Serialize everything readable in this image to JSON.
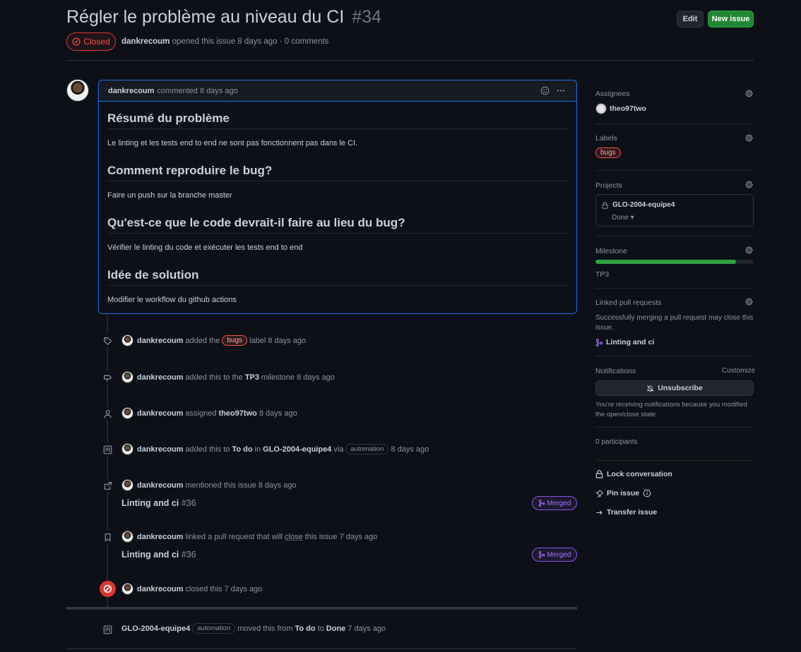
{
  "issue": {
    "title": "Régler le problème au niveau du CI",
    "number": "#34",
    "state": "Closed",
    "author": "dankrecoum",
    "opened_text": "opened this issue 8 days ago · 0 comments"
  },
  "header_buttons": {
    "edit": "Edit",
    "new_issue": "New issue"
  },
  "comment": {
    "author": "dankrecoum",
    "action": "commented 8 days ago",
    "sections": [
      {
        "heading": "Résumé du problème",
        "text": "Le linting et les tests end to end ne sont pas fonctionnent pas dans le CI."
      },
      {
        "heading": "Comment reproduire le bug?",
        "text": "Faire un push sur la branche master"
      },
      {
        "heading": "Qu'est-ce que le code devrait-il faire au lieu du bug?",
        "text": "Vérifier le linting du code et exécuter les tests end to end"
      },
      {
        "heading": "Idée de solution",
        "text": "Modifier le workflow du github actions"
      }
    ]
  },
  "timeline": {
    "label_event": {
      "actor": "dankrecoum",
      "pre": "added the",
      "label": "bugs",
      "post": "label 8 days ago"
    },
    "milestone_event": {
      "actor": "dankrecoum",
      "pre": "added this to the",
      "milestone": "TP3",
      "post": "milestone 8 days ago"
    },
    "assign_event": {
      "actor": "dankrecoum",
      "pre": "assigned",
      "assignee": "theo97two",
      "post": "8 days ago"
    },
    "project_event": {
      "actor": "dankrecoum",
      "pre": "added this to",
      "column": "To do",
      "in": "in",
      "project": "GLO-2004-equipe4",
      "via": "via",
      "badge": "automation",
      "post": "8 days ago"
    },
    "mention_event": {
      "actor": "dankrecoum",
      "text": "mentioned this issue 8 days ago",
      "pr_title": "Linting and ci",
      "pr_number": "#36",
      "pr_state": "Merged"
    },
    "link_event": {
      "actor": "dankrecoum",
      "pre": "linked a pull request that will",
      "close": "close",
      "post": "this issue 7 days ago",
      "pr_title": "Linting and ci",
      "pr_number": "#36",
      "pr_state": "Merged"
    },
    "close_event": {
      "actor": "dankrecoum",
      "text": "closed this 7 days ago"
    },
    "move_event": {
      "actor": "GLO-2004-equipe4",
      "badge": "automation",
      "pre": "moved this from",
      "from": "To do",
      "to_word": "to",
      "to": "Done",
      "post": "7 days ago"
    }
  },
  "sidebar": {
    "assignees": {
      "title": "Assignees",
      "name": "theo97two"
    },
    "labels": {
      "title": "Labels",
      "label": "bugs"
    },
    "projects": {
      "title": "Projects",
      "name": "GLO-2004-equipe4",
      "status": "Done ▾"
    },
    "milestone": {
      "title": "Milestone",
      "name": "TP3",
      "progress": 0.89
    },
    "linked_prs": {
      "title": "Linked pull requests",
      "description": "Successfully merging a pull request may close this issue.",
      "pr": "Linting and ci"
    },
    "notifications": {
      "title": "Notifications",
      "customize": "Customize",
      "button": "Unsubscribe",
      "description": "You're receiving notifications because you modified the open/close state."
    },
    "participants": "0 participants",
    "actions": {
      "lock": "Lock conversation",
      "pin": "Pin issue",
      "transfer": "Transfer issue"
    }
  },
  "colors": {
    "closed_red": "#da3633",
    "merged_purple": "#8957e5",
    "primary_green": "#238636",
    "accent_blue": "#1f6feb"
  }
}
